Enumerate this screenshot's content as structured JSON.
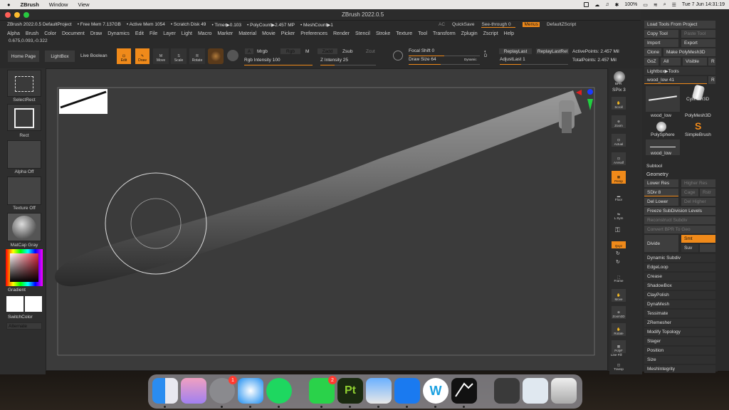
{
  "macbar": {
    "app": "ZBrush",
    "menus": [
      "Window",
      "View"
    ],
    "battery": "100%",
    "datetime": "Tue 7 Jun  14:31:19"
  },
  "window": {
    "title": "ZBrush 2022.0.5"
  },
  "info": {
    "project": "ZBrush 2022.0.5 DefaultProject",
    "free_mem": "• Free Mem 7.137GB",
    "active_mem": "• Active Mem 1054",
    "scratch": "• Scratch Disk 49",
    "timer": "• Timer▶0.103",
    "polycount": "• PolyCount▶2.457 MP",
    "meshcount": "• MeshCount▶1"
  },
  "topright": {
    "ac": "AC",
    "quicksave": "QuickSave",
    "seethrough": "See-through  0",
    "menus": "Menus",
    "script": "DefaultZScript"
  },
  "menus": [
    "Alpha",
    "Brush",
    "Color",
    "Document",
    "Draw",
    "Dynamics",
    "Edit",
    "File",
    "Layer",
    "Light",
    "Macro",
    "Marker",
    "Material",
    "Movie",
    "Picker",
    "Preferences",
    "Render",
    "Stencil",
    "Stroke",
    "Texture",
    "Tool",
    "Transform",
    "Zplugin",
    "Zscript",
    "Help"
  ],
  "coords": "0.675,0.093,-0.322",
  "toolbar": {
    "home": "Home Page",
    "lightbox": "LightBox",
    "liveboolean": "Live Boolean",
    "edit": "Edit",
    "draw": "Draw",
    "move": "Move",
    "scale": "Scale",
    "rotate": "Rotate",
    "a": "A",
    "mrgb": "Mrgb",
    "rgb": "Rgb",
    "m": "M",
    "zadd": "Zadd",
    "zsub": "Zsub",
    "zcut": "Zcut",
    "rgb_intensity": "Rgb Intensity 100",
    "z_intensity": "Z Intensity 25",
    "focal_shift": "Focal Shift 0",
    "draw_size": "Draw Size 64",
    "dynamic": "Dynamic",
    "replaylast": "ReplayLast",
    "replaylastrel": "ReplayLastRel",
    "adjustlast": "AdjustLast 1",
    "activepoints": "ActivePoints: 2.457 Mil",
    "totalpoints": "TotalPoints: 2.457 Mil",
    "d": "D"
  },
  "left": {
    "selectrect": "SelectRect",
    "rect": "Rect",
    "alpha": "Alpha Off",
    "texture": "Texture Off",
    "matcap": "MatCap Gray",
    "gradient": "Gradient",
    "switchcolor": "SwitchColor",
    "alternate": "Alternate"
  },
  "right": {
    "bpr": "BPR",
    "spix": "SPix 3",
    "scroll": "Scroll",
    "zoom": "Zoom",
    "actual": "Actual",
    "aahalf": "AAHalf",
    "persp": "Persp",
    "floor": "Floor",
    "lsym": "L.Sym",
    "qxyz": "Qxyz",
    "frame": "Frame",
    "move": "Move",
    "zoom3d": "Zoom3D",
    "rotate": "Rotate",
    "polyf": "PolyF",
    "linefill": "Line Fill",
    "transp": "Transp"
  },
  "tool": {
    "load": "Load Tools From Project",
    "copy": "Copy Tool",
    "paste": "Paste Tool",
    "import": "Import",
    "export": "Export",
    "clone": "Clone",
    "makepoly": "Make PolyMesh3D",
    "goz": "GoZ",
    "all": "All",
    "visible": "Visible",
    "r": "R",
    "lightbox": "Lightbox▶Tools",
    "current": "wood_low  41",
    "r2": "R",
    "items": [
      "wood_low",
      "Cylinder3D",
      "PolyMesh3D",
      "PolySphere",
      "SimpleBrush",
      "wood_low"
    ],
    "subtool": "Subtool",
    "geometry": "Geometry",
    "lowerres": "Lower Res",
    "higherres": "Higher Res",
    "sdiv": "SDiv 8",
    "cage": "Cage",
    "rstr": "Rstr",
    "dellower": "Del Lower",
    "delhigher": "Del Higher",
    "freeze": "Freeze SubDivision Levels",
    "reconstruct": "Reconstruct Subdiv",
    "convert": "Convert BPR To Geo",
    "divide": "Divide",
    "smt": "Smt",
    "suv": "Suv",
    "reluv": "ReUV",
    "sections": [
      "Dynamic Subdiv",
      "EdgeLoop",
      "Crease",
      "ShadowBox",
      "ClayPolish",
      "DynaMesh",
      "Tessimate",
      "ZRemesher",
      "Modify Topology",
      "Stager",
      "Position",
      "Size",
      "MeshIntegrity"
    ]
  },
  "dock": {
    "settings_badge": "1",
    "messages_badge": "2",
    "pt": "Pt",
    "w": "W"
  }
}
